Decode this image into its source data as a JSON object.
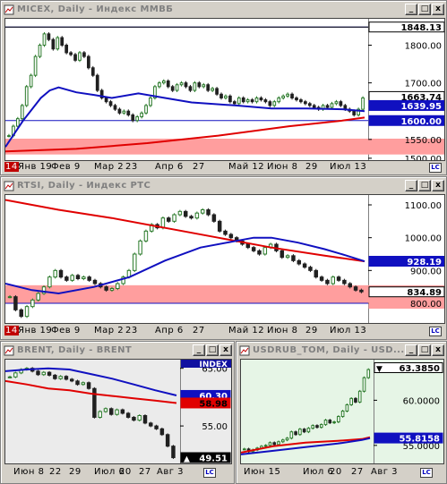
{
  "colors": {
    "ma_blue": "#1010c0",
    "ma_red": "#e00000",
    "candle_up": "#2a7a2a",
    "candle_down": "#202020",
    "zone_pink": "#ff9e9e",
    "frame_bg": "#d4d0c8"
  },
  "icons": {
    "title": "chart-icon",
    "minimize": "minimize-icon",
    "maximize": "maximize-icon",
    "close": "close-icon",
    "corner": "lc-corner-icon"
  },
  "windows": [
    {
      "id": "micex",
      "title": "MICEX, Daily - Индекс ММВБ",
      "buttons": [
        "_",
        "□",
        "x"
      ],
      "background": "#ffffff",
      "chart_data": {
        "type": "candlestick",
        "ylim": [
          1495,
          1870
        ],
        "x_labels": [
          "14",
          "Янв 19",
          "Фев 9",
          "Мар 2",
          "23",
          "Апр 6",
          "27",
          "Май 12",
          "Июн 8",
          "29",
          "Июл 13"
        ],
        "price_labels": [
          "1800.00",
          "1700.00",
          "1550.00",
          "1500.00"
        ],
        "markers": [
          {
            "label": "1848.13",
            "value": 1848.13,
            "style": "line-white"
          },
          {
            "label": "1663.74",
            "value": 1663.74,
            "style": "white"
          },
          {
            "label": "1639.95",
            "value": 1639.95,
            "style": "blue"
          },
          {
            "label": "1600.00",
            "value": 1600.0,
            "style": "blue"
          }
        ],
        "hlines": [
          1848.13,
          1600.0
        ],
        "zone": [
          1510,
          1552
        ],
        "closes": [
          1560,
          1585,
          1605,
          1640,
          1690,
          1720,
          1770,
          1800,
          1830,
          1815,
          1790,
          1820,
          1800,
          1780,
          1775,
          1760,
          1780,
          1770,
          1740,
          1720,
          1680,
          1660,
          1650,
          1640,
          1630,
          1620,
          1625,
          1615,
          1600,
          1610,
          1620,
          1640,
          1660,
          1690,
          1700,
          1705,
          1690,
          1680,
          1695,
          1700,
          1690,
          1680,
          1700,
          1690,
          1695,
          1680,
          1685,
          1670,
          1660,
          1665,
          1650,
          1645,
          1660,
          1650,
          1655,
          1650,
          1660,
          1655,
          1650,
          1640,
          1650,
          1660,
          1665,
          1670,
          1660,
          1655,
          1650,
          1645,
          1640,
          1635,
          1630,
          1640,
          1635,
          1645,
          1650,
          1640,
          1630,
          1625,
          1615,
          1630,
          1660
        ],
        "ma_blue": [
          [
            0,
            1530
          ],
          [
            20,
            1600
          ],
          [
            40,
            1660
          ],
          [
            50,
            1680
          ],
          [
            60,
            1688
          ],
          [
            80,
            1675
          ],
          [
            100,
            1668
          ],
          [
            120,
            1660
          ],
          [
            150,
            1672
          ],
          [
            180,
            1660
          ],
          [
            210,
            1648
          ],
          [
            260,
            1640
          ],
          [
            300,
            1632
          ],
          [
            340,
            1632
          ],
          [
            380,
            1630
          ],
          [
            405,
            1625
          ]
        ],
        "ma_red": [
          [
            0,
            1518
          ],
          [
            80,
            1525
          ],
          [
            160,
            1540
          ],
          [
            240,
            1560
          ],
          [
            320,
            1585
          ],
          [
            380,
            1600
          ],
          [
            405,
            1608
          ]
        ]
      }
    },
    {
      "id": "rtsi",
      "title": "RTSI, Daily - Индекс РТС",
      "buttons": [
        "_",
        "□",
        "x"
      ],
      "background": "#ffffff",
      "chart_data": {
        "type": "candlestick",
        "ylim": [
          740,
          1130
        ],
        "x_labels": [
          "14",
          "Янв 19",
          "Фев 9",
          "Мар 2",
          "23",
          "Апр 6",
          "27",
          "Май 12",
          "Июн 8",
          "29",
          "Июл 13"
        ],
        "price_labels": [
          "1100.00",
          "1000.00",
          "900.00",
          "800.00"
        ],
        "markers": [
          {
            "label": "928.19",
            "value": 928.19,
            "style": "blue"
          },
          {
            "label": "834.89",
            "value": 834.89,
            "style": "white"
          },
          {
            "label": "800.00",
            "value": 800.0,
            "style": "pink"
          }
        ],
        "hlines": [
          800.0
        ],
        "zone": [
          800,
          855
        ],
        "closes": [
          820,
          780,
          760,
          790,
          810,
          830,
          850,
          880,
          900,
          880,
          870,
          885,
          875,
          880,
          870,
          860,
          850,
          840,
          845,
          860,
          880,
          900,
          950,
          990,
          1020,
          1040,
          1030,
          1060,
          1050,
          1070,
          1080,
          1065,
          1060,
          1075,
          1085,
          1070,
          1050,
          1020,
          1010,
          1000,
          990,
          980,
          970,
          960,
          950,
          970,
          980,
          960,
          940,
          945,
          930,
          920,
          910,
          900,
          880,
          870,
          860,
          880,
          870,
          860,
          850,
          840,
          835
        ],
        "ma_blue": [
          [
            0,
            860
          ],
          [
            30,
            840
          ],
          [
            60,
            830
          ],
          [
            100,
            850
          ],
          [
            140,
            880
          ],
          [
            180,
            930
          ],
          [
            220,
            970
          ],
          [
            260,
            990
          ],
          [
            280,
            1000
          ],
          [
            300,
            1000
          ],
          [
            330,
            985
          ],
          [
            360,
            965
          ],
          [
            385,
            945
          ],
          [
            405,
            928
          ]
        ],
        "ma_red": [
          [
            0,
            1115
          ],
          [
            60,
            1085
          ],
          [
            120,
            1060
          ],
          [
            180,
            1030
          ],
          [
            240,
            1000
          ],
          [
            300,
            970
          ],
          [
            360,
            945
          ],
          [
            405,
            928
          ]
        ]
      }
    },
    {
      "id": "brent",
      "title": "BRENT, Daily - BRENT",
      "buttons": [
        "_",
        "□",
        "x"
      ],
      "background": "#ebebeb",
      "chart_data": {
        "type": "candlestick",
        "ylim": [
          48.5,
          66.5
        ],
        "x_labels": [
          "Июн 8",
          "22",
          "29",
          "Июл 6",
          "20",
          "27",
          "Авг 3"
        ],
        "header_label": "INDEX",
        "price_labels": [
          "65.00",
          "55.00"
        ],
        "markers": [
          {
            "label": "60.30",
            "value": 60.3,
            "style": "blue"
          },
          {
            "label": "58.98",
            "value": 58.98,
            "style": "red"
          },
          {
            "label": "49.51",
            "value": 49.51,
            "style": "black"
          }
        ],
        "closes": [
          63.5,
          64.2,
          64.8,
          65.0,
          64.5,
          63.9,
          64.3,
          63.8,
          63.2,
          63.6,
          63.1,
          62.8,
          62.2,
          62.5,
          61.5,
          56.5,
          57.5,
          58.0,
          57.0,
          57.8,
          57.2,
          56.5,
          56.0,
          56.8,
          55.5,
          55.0,
          54.5,
          53.5,
          51.5,
          49.5
        ],
        "ma_blue": [
          [
            0,
            64.5
          ],
          [
            20,
            64.8
          ],
          [
            40,
            65.0
          ],
          [
            60,
            64.8
          ],
          [
            80,
            64.0
          ],
          [
            100,
            63.2
          ],
          [
            120,
            62.2
          ],
          [
            140,
            61.2
          ],
          [
            160,
            60.3
          ]
        ],
        "ma_red": [
          [
            0,
            62.8
          ],
          [
            20,
            62.2
          ],
          [
            40,
            61.5
          ],
          [
            60,
            61.2
          ],
          [
            80,
            60.6
          ],
          [
            100,
            60.2
          ],
          [
            120,
            59.8
          ],
          [
            140,
            59.4
          ],
          [
            160,
            58.98
          ]
        ]
      }
    },
    {
      "id": "usdrub",
      "title": "USDRUB_TOM, Daily - USD...",
      "buttons": [
        "_",
        "□",
        "x"
      ],
      "background": "#e6f5e6",
      "chart_data": {
        "type": "candlestick",
        "ylim": [
          53.0,
          64.5
        ],
        "x_labels": [
          "Июн 15",
          "Июл 6",
          "20",
          "27",
          "Авг 3"
        ],
        "price_labels": [
          "60.0000",
          "55.0000"
        ],
        "markers": [
          {
            "label": "63.3850",
            "value": 63.385,
            "style": "black-top"
          },
          {
            "label": "55.8158",
            "value": 55.8158,
            "style": "blue"
          }
        ],
        "closes": [
          54.6,
          54.3,
          54.5,
          54.7,
          54.9,
          55.0,
          55.3,
          55.1,
          55.4,
          55.6,
          55.8,
          56.5,
          56.2,
          56.8,
          56.5,
          56.9,
          57.2,
          57.0,
          57.3,
          57.8,
          57.5,
          57.6,
          58.2,
          58.8,
          59.5,
          60.2,
          59.8,
          61.0,
          62.5,
          63.4
        ],
        "ma_blue": [
          [
            0,
            54.0
          ],
          [
            40,
            54.4
          ],
          [
            80,
            54.8
          ],
          [
            120,
            55.2
          ],
          [
            150,
            55.6
          ],
          [
            160,
            55.8
          ]
        ],
        "ma_red": [
          [
            0,
            54.2
          ],
          [
            40,
            54.9
          ],
          [
            80,
            55.3
          ],
          [
            120,
            55.5
          ],
          [
            150,
            55.7
          ],
          [
            160,
            55.9
          ]
        ]
      }
    }
  ]
}
